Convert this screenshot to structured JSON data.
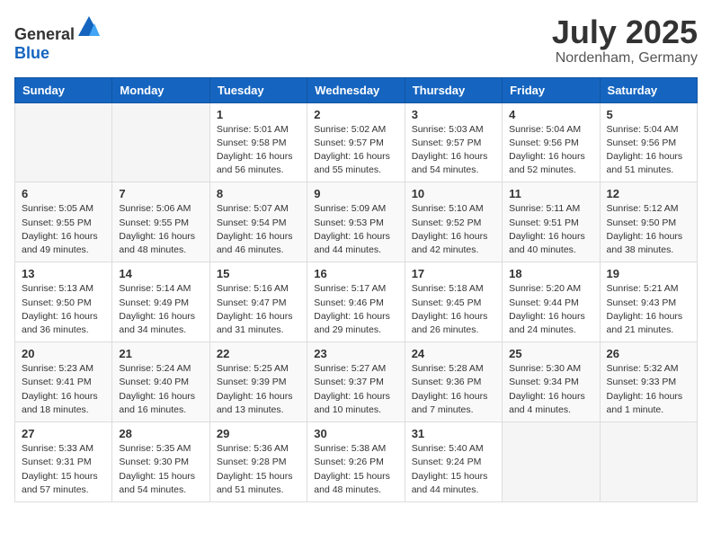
{
  "header": {
    "logo_general": "General",
    "logo_blue": "Blue",
    "month": "July 2025",
    "location": "Nordenham, Germany"
  },
  "days_of_week": [
    "Sunday",
    "Monday",
    "Tuesday",
    "Wednesday",
    "Thursday",
    "Friday",
    "Saturday"
  ],
  "weeks": [
    [
      {
        "day": "",
        "content": ""
      },
      {
        "day": "",
        "content": ""
      },
      {
        "day": "1",
        "content": "Sunrise: 5:01 AM\nSunset: 9:58 PM\nDaylight: 16 hours\nand 56 minutes."
      },
      {
        "day": "2",
        "content": "Sunrise: 5:02 AM\nSunset: 9:57 PM\nDaylight: 16 hours\nand 55 minutes."
      },
      {
        "day": "3",
        "content": "Sunrise: 5:03 AM\nSunset: 9:57 PM\nDaylight: 16 hours\nand 54 minutes."
      },
      {
        "day": "4",
        "content": "Sunrise: 5:04 AM\nSunset: 9:56 PM\nDaylight: 16 hours\nand 52 minutes."
      },
      {
        "day": "5",
        "content": "Sunrise: 5:04 AM\nSunset: 9:56 PM\nDaylight: 16 hours\nand 51 minutes."
      }
    ],
    [
      {
        "day": "6",
        "content": "Sunrise: 5:05 AM\nSunset: 9:55 PM\nDaylight: 16 hours\nand 49 minutes."
      },
      {
        "day": "7",
        "content": "Sunrise: 5:06 AM\nSunset: 9:55 PM\nDaylight: 16 hours\nand 48 minutes."
      },
      {
        "day": "8",
        "content": "Sunrise: 5:07 AM\nSunset: 9:54 PM\nDaylight: 16 hours\nand 46 minutes."
      },
      {
        "day": "9",
        "content": "Sunrise: 5:09 AM\nSunset: 9:53 PM\nDaylight: 16 hours\nand 44 minutes."
      },
      {
        "day": "10",
        "content": "Sunrise: 5:10 AM\nSunset: 9:52 PM\nDaylight: 16 hours\nand 42 minutes."
      },
      {
        "day": "11",
        "content": "Sunrise: 5:11 AM\nSunset: 9:51 PM\nDaylight: 16 hours\nand 40 minutes."
      },
      {
        "day": "12",
        "content": "Sunrise: 5:12 AM\nSunset: 9:50 PM\nDaylight: 16 hours\nand 38 minutes."
      }
    ],
    [
      {
        "day": "13",
        "content": "Sunrise: 5:13 AM\nSunset: 9:50 PM\nDaylight: 16 hours\nand 36 minutes."
      },
      {
        "day": "14",
        "content": "Sunrise: 5:14 AM\nSunset: 9:49 PM\nDaylight: 16 hours\nand 34 minutes."
      },
      {
        "day": "15",
        "content": "Sunrise: 5:16 AM\nSunset: 9:47 PM\nDaylight: 16 hours\nand 31 minutes."
      },
      {
        "day": "16",
        "content": "Sunrise: 5:17 AM\nSunset: 9:46 PM\nDaylight: 16 hours\nand 29 minutes."
      },
      {
        "day": "17",
        "content": "Sunrise: 5:18 AM\nSunset: 9:45 PM\nDaylight: 16 hours\nand 26 minutes."
      },
      {
        "day": "18",
        "content": "Sunrise: 5:20 AM\nSunset: 9:44 PM\nDaylight: 16 hours\nand 24 minutes."
      },
      {
        "day": "19",
        "content": "Sunrise: 5:21 AM\nSunset: 9:43 PM\nDaylight: 16 hours\nand 21 minutes."
      }
    ],
    [
      {
        "day": "20",
        "content": "Sunrise: 5:23 AM\nSunset: 9:41 PM\nDaylight: 16 hours\nand 18 minutes."
      },
      {
        "day": "21",
        "content": "Sunrise: 5:24 AM\nSunset: 9:40 PM\nDaylight: 16 hours\nand 16 minutes."
      },
      {
        "day": "22",
        "content": "Sunrise: 5:25 AM\nSunset: 9:39 PM\nDaylight: 16 hours\nand 13 minutes."
      },
      {
        "day": "23",
        "content": "Sunrise: 5:27 AM\nSunset: 9:37 PM\nDaylight: 16 hours\nand 10 minutes."
      },
      {
        "day": "24",
        "content": "Sunrise: 5:28 AM\nSunset: 9:36 PM\nDaylight: 16 hours\nand 7 minutes."
      },
      {
        "day": "25",
        "content": "Sunrise: 5:30 AM\nSunset: 9:34 PM\nDaylight: 16 hours\nand 4 minutes."
      },
      {
        "day": "26",
        "content": "Sunrise: 5:32 AM\nSunset: 9:33 PM\nDaylight: 16 hours\nand 1 minute."
      }
    ],
    [
      {
        "day": "27",
        "content": "Sunrise: 5:33 AM\nSunset: 9:31 PM\nDaylight: 15 hours\nand 57 minutes."
      },
      {
        "day": "28",
        "content": "Sunrise: 5:35 AM\nSunset: 9:30 PM\nDaylight: 15 hours\nand 54 minutes."
      },
      {
        "day": "29",
        "content": "Sunrise: 5:36 AM\nSunset: 9:28 PM\nDaylight: 15 hours\nand 51 minutes."
      },
      {
        "day": "30",
        "content": "Sunrise: 5:38 AM\nSunset: 9:26 PM\nDaylight: 15 hours\nand 48 minutes."
      },
      {
        "day": "31",
        "content": "Sunrise: 5:40 AM\nSunset: 9:24 PM\nDaylight: 15 hours\nand 44 minutes."
      },
      {
        "day": "",
        "content": ""
      },
      {
        "day": "",
        "content": ""
      }
    ]
  ]
}
